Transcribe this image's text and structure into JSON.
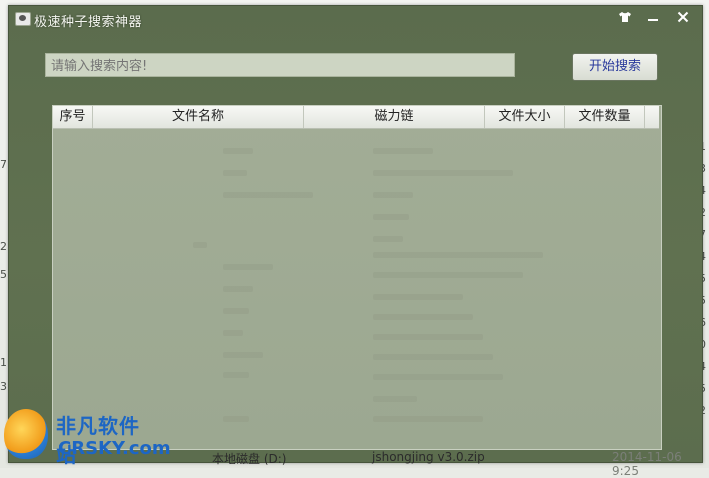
{
  "window": {
    "title": "极速种子搜索神器",
    "skin_icon": "shirt-icon",
    "minimize_icon": "minimize-icon",
    "close_icon": "close-icon"
  },
  "search": {
    "placeholder": "请输入搜索内容!",
    "button_label": "开始搜索"
  },
  "table": {
    "columns": [
      "序号",
      "文件名称",
      "磁力链",
      "文件大小",
      "文件数量"
    ],
    "rows": []
  },
  "background_fragments": {
    "left_digits": [
      "7",
      "2",
      "5",
      "1",
      "3"
    ],
    "right_digits": [
      "1",
      "3",
      "4",
      "2",
      "7",
      "4",
      "5",
      "5",
      "6",
      "0",
      "4",
      "5",
      "2"
    ],
    "bottom_drive": "本地磁盘 (D:)",
    "bottom_file": "jshongjing v3.0.zip",
    "bottom_date": "2014-11-06 9:25"
  },
  "watermark": {
    "cn": "非凡软件站",
    "en": "CRSKY.com"
  },
  "colors": {
    "window_bg": "#5d6e4f",
    "grid_bg": "#9faa93",
    "accent_text": "#2c4bb0"
  }
}
